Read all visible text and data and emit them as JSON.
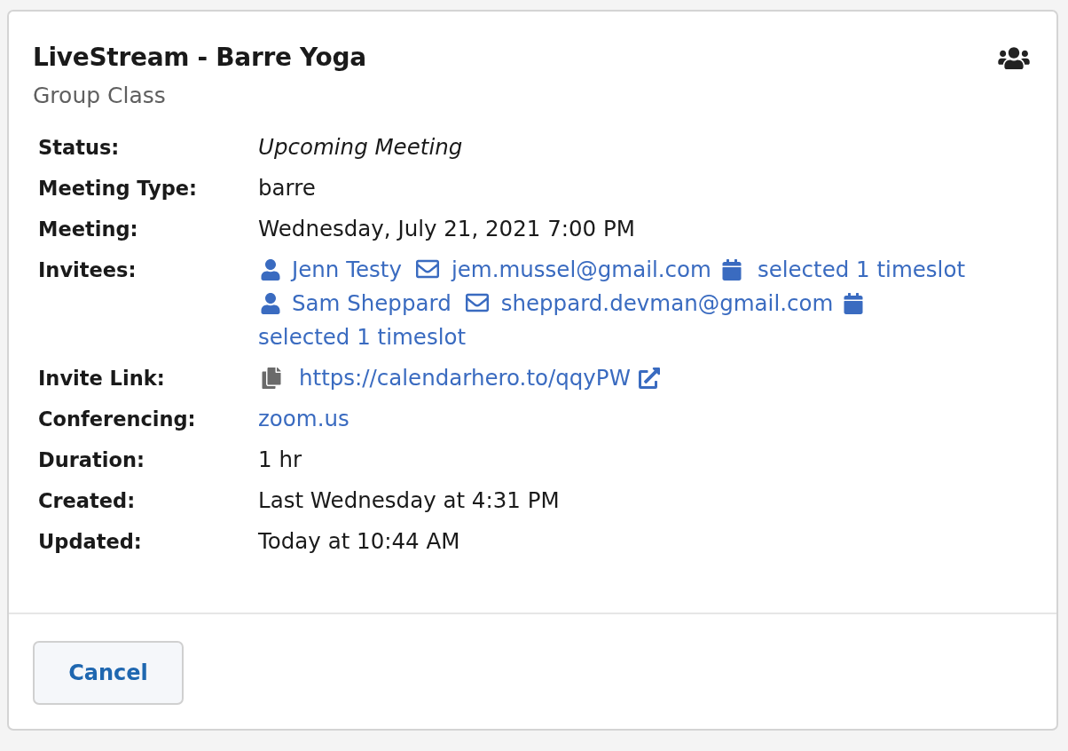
{
  "header": {
    "title": "LiveStream - Barre Yoga",
    "subtitle": "Group Class"
  },
  "details": [
    {
      "kind": "italic",
      "label": "Status:",
      "value": "Upcoming Meeting"
    },
    {
      "kind": "text",
      "label": "Meeting Type:",
      "value": "barre"
    },
    {
      "kind": "text",
      "label": "Meeting:",
      "value": "Wednesday, July 21, 2021 7:00 PM"
    },
    {
      "kind": "invitees",
      "label": "Invitees:",
      "invitees": [
        {
          "name": "Jenn Testy",
          "email": "jem.mussel@gmail.com",
          "timeslots": "selected 1 timeslot"
        },
        {
          "name": "Sam Sheppard",
          "email": "sheppard.devman@gmail.com",
          "timeslots": "selected 1 timeslot"
        }
      ]
    },
    {
      "kind": "invite_link",
      "label": "Invite Link:",
      "value": "https://calendarhero.to/qqyPW"
    },
    {
      "kind": "link",
      "label": "Conferencing:",
      "value": "zoom.us"
    },
    {
      "kind": "text",
      "label": "Duration:",
      "value": "1 hr"
    },
    {
      "kind": "text",
      "label": "Created:",
      "value": "Last Wednesday at 4:31 PM"
    },
    {
      "kind": "text",
      "label": "Updated:",
      "value": "Today at 10:44 AM"
    }
  ],
  "footer": {
    "buttons": [
      "Cancel"
    ]
  }
}
